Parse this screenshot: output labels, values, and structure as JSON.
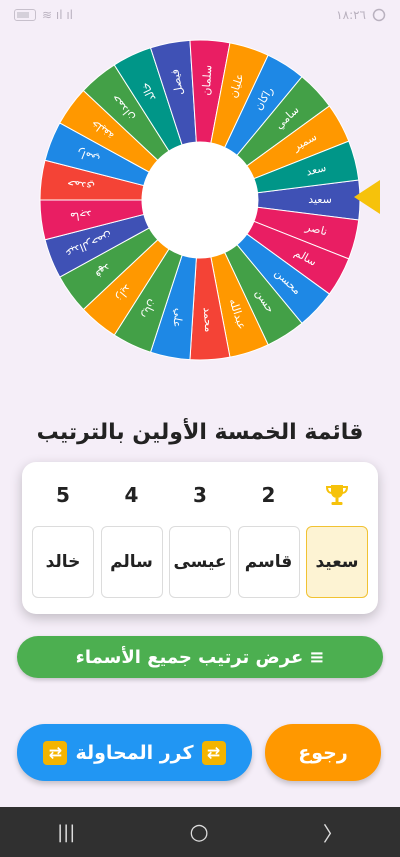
{
  "status": {
    "time": "١٨:٢٦",
    "signal": "≋ ıl ıl"
  },
  "wheel": {
    "names": [
      "سعيد",
      "ناصر",
      "سالم",
      "محسن",
      "حسن",
      "عبدالله",
      "محمد",
      "علي",
      "ريان",
      "زايد",
      "فهد",
      "عبدالرحمن",
      "ماجد",
      "حمدي",
      "رامي",
      "خليفة",
      "حمدان",
      "خالد",
      "فيصل",
      "سلمان",
      "عليان",
      "راكان",
      "سامي",
      "سمير",
      "سعد"
    ],
    "colors": [
      "#3f51b5",
      "#e91e63",
      "#e91e63",
      "#1e88e5",
      "#43a047",
      "#ff9800",
      "#f44336",
      "#1e88e5",
      "#43a047",
      "#ff9800",
      "#43a047",
      "#3f51b5",
      "#e91e63",
      "#f44336",
      "#1e88e5",
      "#ff9800",
      "#43a047",
      "#009688",
      "#3f51b5",
      "#e91e63",
      "#ff9800",
      "#1e88e5",
      "#43a047",
      "#ff9800",
      "#009688"
    ]
  },
  "results": {
    "title": "قائمة الخمسة الأولين بالترتيب",
    "ranks": [
      "5",
      "4",
      "3",
      "2"
    ],
    "names": [
      "خالد",
      "سالم",
      "عيسى",
      "قاسم",
      "سعيد"
    ]
  },
  "buttons": {
    "show_all": "عرض ترتيب جميع الأسماء",
    "show_all_icon": "≡",
    "retry": "كرر المحاولة",
    "back": "رجوع"
  },
  "nav": {
    "recents": "|||",
    "home": "○",
    "back": "〉"
  }
}
